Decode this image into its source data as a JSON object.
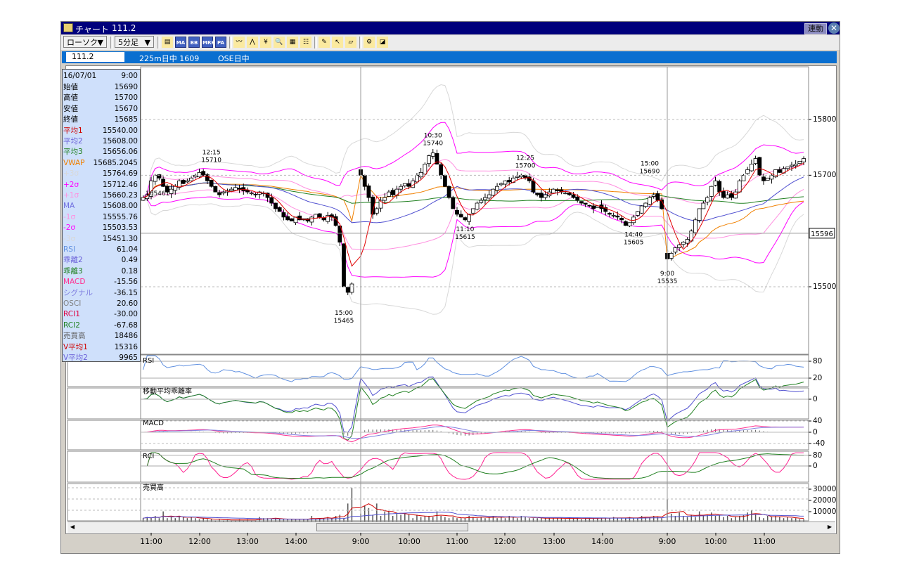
{
  "window": {
    "title": "チャート",
    "symbol": "111.2",
    "link_button": "連動",
    "close_icon": "close-icon"
  },
  "toolbar": {
    "chart_type": "ローソク",
    "period": "5分足",
    "icons": [
      "symbol-list-icon",
      "ma-icon",
      "bb-icon",
      "mre-icon",
      "pa-icon",
      "line-chart-icon",
      "trend-icon",
      "yen-icon",
      "zoom-icon",
      "calculator-icon",
      "table-icon",
      "pen-icon",
      "pointer-icon",
      "eraser-icon",
      "settings-gear-icon",
      "compass-icon"
    ],
    "icon_labels": {
      "ma-icon": "MA",
      "bb-icon": "BB",
      "mre-icon": "MRE",
      "pa-icon": "PA"
    }
  },
  "infobar": {
    "symbol_input": "111.2",
    "contract": "225m日中 1609",
    "market": "OSE日中"
  },
  "data_panel": {
    "date": "16/07/01",
    "time": "9:00",
    "rows": [
      {
        "label": "始値",
        "value": "15690",
        "color": "#000000"
      },
      {
        "label": "高値",
        "value": "15700",
        "color": "#000000"
      },
      {
        "label": "安値",
        "value": "15670",
        "color": "#000000"
      },
      {
        "label": "終値",
        "value": "15685",
        "color": "#000000"
      },
      {
        "label": "平均1",
        "value": "15540.00",
        "color": "#d00000"
      },
      {
        "label": "平均2",
        "value": "15608.00",
        "color": "#6a5fd8"
      },
      {
        "label": "平均3",
        "value": "15656.06",
        "color": "#208020"
      },
      {
        "label": "VWAP",
        "value": "15685.2045",
        "color": "#f08000"
      },
      {
        "label": "+3σ",
        "value": "15764.69",
        "color": "#d8d8d8"
      },
      {
        "label": "+2σ",
        "value": "15712.46",
        "color": "#ff00ff"
      },
      {
        "label": "+1σ",
        "value": "15660.23",
        "color": "#ff90e0"
      },
      {
        "label": "MA",
        "value": "15608.00",
        "color": "#7070e0"
      },
      {
        "label": "-1σ",
        "value": "15555.76",
        "color": "#ff90e0"
      },
      {
        "label": "-2σ",
        "value": "15503.53",
        "color": "#ff00ff"
      },
      {
        "label": "-3σ",
        "value": "15451.30",
        "color": "#d8d8d8"
      },
      {
        "label": "RSI",
        "value": "61.04",
        "color": "#6090e0"
      },
      {
        "label": "乖離2",
        "value": "0.49",
        "color": "#6a5fd8"
      },
      {
        "label": "乖離3",
        "value": "0.18",
        "color": "#208020"
      },
      {
        "label": "MACD",
        "value": "-15.56",
        "color": "#ff3090"
      },
      {
        "label": "シグナル",
        "value": "-36.15",
        "color": "#8080e0"
      },
      {
        "label": "OSCI",
        "value": "20.60",
        "color": "#808080"
      },
      {
        "label": "RCI1",
        "value": "-30.00",
        "color": "#e00040"
      },
      {
        "label": "RCI2",
        "value": "-67.68",
        "color": "#208020"
      },
      {
        "label": "売買高",
        "value": "18486",
        "color": "#606060"
      },
      {
        "label": "V平均1",
        "value": "15316",
        "color": "#d00000"
      },
      {
        "label": "V平均2",
        "value": "9965",
        "color": "#6a5fd8"
      }
    ]
  },
  "panels": {
    "rsi": {
      "title": "RSI",
      "ticks": [
        "80",
        "20"
      ]
    },
    "deviation": {
      "title": "移動平均乖離率",
      "ticks": [
        "0"
      ]
    },
    "macd": {
      "title": "MACD",
      "ticks": [
        "40",
        "0",
        "-40"
      ]
    },
    "rci": {
      "title": "RCI",
      "ticks": [
        "80",
        "0"
      ]
    },
    "volume": {
      "title": "売買高",
      "ticks": [
        "30000",
        "20000",
        "10000"
      ]
    }
  },
  "price_axis": {
    "ticks": [
      "15800",
      "15700",
      "15500"
    ],
    "current_price": "15596"
  },
  "x_axis": {
    "labels": [
      "11:00",
      "12:00",
      "13:00",
      "14:00",
      "9:00",
      "10:00",
      "11:00",
      "12:00",
      "13:00",
      "14:00",
      "9:00",
      "10:00",
      "11:00"
    ]
  },
  "cursor_label": "165461",
  "chart_data": {
    "type": "candlestick",
    "interval_minutes": 5,
    "days": [
      {
        "start": "10:50",
        "closes": [
          15660,
          15665,
          15690,
          15700,
          15695,
          15680,
          15670,
          15675,
          15680,
          15690,
          15685,
          15690,
          15695,
          15700,
          15705,
          15700,
          15690,
          15680,
          15670,
          15665,
          15670,
          15672,
          15675,
          15678,
          15675,
          15672,
          15670,
          15668,
          15665,
          15670,
          15668,
          15660,
          15650,
          15640,
          15635,
          15625,
          15620,
          15618,
          15625,
          15620,
          15622,
          15618,
          15625,
          15630,
          15625,
          15620,
          15628,
          15625,
          15610,
          15580,
          15500,
          15490,
          15505
        ],
        "volumes": [
          3000,
          4000,
          3000,
          5000,
          3000,
          9000,
          3000,
          4000,
          3000,
          5000,
          4000,
          3000,
          4000,
          3000,
          2000,
          3000,
          2000,
          2000,
          1000,
          2000,
          1000,
          2000,
          1000,
          1000,
          2000,
          1000,
          2000,
          1000,
          1000,
          4000,
          3000,
          3000,
          2000,
          3000,
          2000,
          2000,
          2000,
          2000,
          2000,
          2000,
          2000,
          2000,
          5000,
          2000,
          3000,
          3000,
          4000,
          3000,
          5000,
          6000,
          3000,
          16000,
          30000
        ]
      },
      {
        "start": "9:00",
        "closes": [
          15700,
          15680,
          15660,
          15630,
          15640,
          15655,
          15660,
          15670,
          15665,
          15675,
          15680,
          15685,
          15680,
          15690,
          15700,
          15705,
          15720,
          15735,
          15740,
          15720,
          15700,
          15680,
          15660,
          15640,
          15630,
          15625,
          15620,
          15630,
          15640,
          15650,
          15655,
          15660,
          15665,
          15675,
          15680,
          15685,
          15690,
          15688,
          15695,
          15698,
          15700,
          15695,
          15690,
          15670,
          15665,
          15660,
          15665,
          15670,
          15675,
          15672,
          15670,
          15668,
          15665,
          15660,
          15655,
          15650,
          15648,
          15645,
          15640,
          15645,
          15640,
          15635,
          15630,
          15628,
          15625,
          15620,
          15610,
          15615,
          15625,
          15635,
          15645,
          15650,
          15660,
          15665,
          15655,
          15640
        ],
        "volumes": [
          7000,
          14000,
          12000,
          6000,
          16000,
          5000,
          9000,
          9000,
          5000,
          8000,
          6000,
          7000,
          6000,
          3000,
          6000,
          4000,
          5000,
          5000,
          4000,
          9000,
          5000,
          4000,
          3000,
          4000,
          3000,
          3000,
          3000,
          5000,
          4000,
          3000,
          4000,
          3000,
          4000,
          5000,
          3000,
          4000,
          3000,
          5000,
          4000,
          3000,
          5000,
          4000,
          3000,
          3000,
          3000,
          3000,
          3000,
          3000,
          3000,
          3000,
          3000,
          2000,
          3000,
          3000,
          3000,
          2000,
          3000,
          3000,
          3000,
          3000,
          3000,
          3000,
          3000,
          4000,
          3000,
          3000,
          3000,
          4000,
          3000,
          3000,
          5000,
          4000,
          4000,
          5000,
          4000,
          3000
        ]
      },
      {
        "start": "9:00",
        "closes": [
          15550,
          15560,
          15570,
          15575,
          15580,
          15585,
          15600,
          15620,
          15640,
          15650,
          15660,
          15680,
          15690,
          15670,
          15660,
          15665,
          15660,
          15670,
          15690,
          15700,
          15710,
          15720,
          15730,
          15700,
          15690,
          15695,
          15700,
          15710,
          15705,
          15712,
          15715,
          15718,
          15720,
          15725,
          15730
        ],
        "volumes": [
          20000,
          7000,
          5000,
          8000,
          5000,
          4000,
          6000,
          4000,
          9000,
          5000,
          6000,
          8000,
          5000,
          6000,
          4000,
          5000,
          3000,
          4000,
          5000,
          6000,
          8000,
          10000,
          6000,
          4000,
          3000,
          5000,
          4000,
          5000,
          4000,
          3000,
          4000,
          3000,
          3000,
          2000,
          2000
        ]
      }
    ],
    "annotations": [
      {
        "day": 0,
        "time": "12:15",
        "price": 15710,
        "kind": "high",
        "time_label": "12:15",
        "price_label": "15710"
      },
      {
        "day": 0,
        "time": "15:00",
        "price": 15465,
        "kind": "low",
        "time_label": "15:00",
        "price_label": "15465"
      },
      {
        "day": 1,
        "time": "10:30",
        "price": 15740,
        "kind": "high",
        "time_label": "10:30",
        "price_label": "15740"
      },
      {
        "day": 1,
        "time": "11:10",
        "price": 15615,
        "kind": "low",
        "time_label": "11:10",
        "price_label": "15615"
      },
      {
        "day": 1,
        "time": "12:25",
        "price": 15700,
        "kind": "high",
        "time_label": "12:25",
        "price_label": "15700"
      },
      {
        "day": 1,
        "time": "14:40",
        "price": 15605,
        "kind": "low",
        "time_label": "14:40",
        "price_label": "15605"
      },
      {
        "day": 1,
        "time": "15:00",
        "price": 15690,
        "kind": "high",
        "time_label": "15:00",
        "price_label": "15690"
      },
      {
        "day": 2,
        "time": "9:00",
        "price": 15535,
        "kind": "low",
        "time_label": "9:00",
        "price_label": "15535"
      }
    ],
    "price_range": [
      15395,
      15900
    ],
    "colors": {
      "up_body": "#ffffff",
      "down_body": "#000000",
      "ma_short": "#e00000",
      "ma_mid": "#5050d0",
      "ma_long": "#208020",
      "vwap": "#f08000",
      "band1": "#ff90e0",
      "band2": "#ff00ff",
      "band3": "#d8d8d8",
      "rsi": "#6090e0",
      "macd": "#ff3090",
      "signal": "#8080e0",
      "osci": "#606060",
      "rci1": "#ff2090",
      "rci2": "#208020",
      "vol": "#555555",
      "vma1": "#d00000",
      "vma2": "#5050d0"
    }
  }
}
